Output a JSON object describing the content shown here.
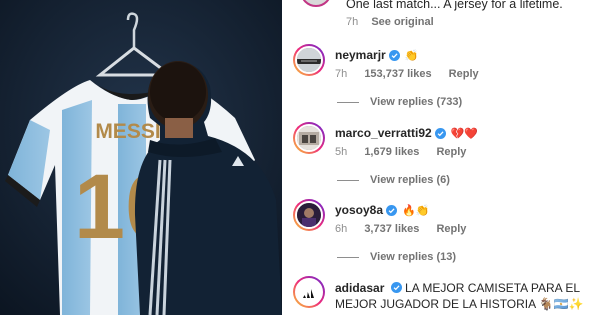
{
  "caption": {
    "text": "One last match... A jersey for a lifetime.",
    "time": "7h",
    "see_original": "See original"
  },
  "photo": {
    "jersey_name": "MESSI",
    "jersey_number": "10"
  },
  "comments": [
    {
      "username": "neymarjr",
      "text": "👏",
      "time": "7h",
      "likes": "153,737 likes",
      "reply": "Reply",
      "view_replies": "View replies (733)"
    },
    {
      "username": "marco_verratti92",
      "text": "💔❤️",
      "time": "5h",
      "likes": "1,679 likes",
      "reply": "Reply",
      "view_replies": "View replies (6)"
    },
    {
      "username": "yosoy8a",
      "text": "🔥👏",
      "time": "6h",
      "likes": "3,737 likes",
      "reply": "Reply",
      "view_replies": "View replies (13)"
    },
    {
      "username": "adidasar",
      "text": "LA MEJOR CAMISETA PARA EL MEJOR JUGADOR DE LA HISTORIA 🐐🇦🇷✨"
    }
  ],
  "colors": {
    "verified": "#3897f0",
    "muted": "#8e8e8e",
    "text": "#262626"
  }
}
